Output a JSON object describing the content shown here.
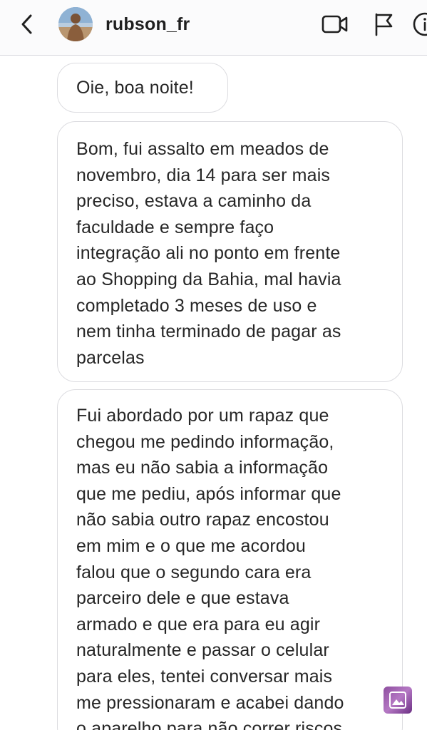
{
  "header": {
    "username": "rubson_fr",
    "icons": [
      "back-arrow-icon",
      "video-call-icon",
      "flag-icon",
      "info-icon"
    ]
  },
  "messages": [
    {
      "text": "Oie, boa noite!"
    },
    {
      "text": "Bom, fui assalto em meados de\nnovembro, dia 14 para ser mais\npreciso, estava a caminho da\nfaculdade e sempre faço\nintegração ali no ponto em frente\nao Shopping da Bahia, mal havia\ncompletado 3 meses de uso e\nnem tinha terminado de pagar as\nparcelas"
    },
    {
      "text": "Fui abordado por um rapaz que\nchegou me pedindo informação,\nmas eu não sabia a informação\nque me pediu, após informar que\nnão sabia outro rapaz encostou\nem mim e o que me acordou\nfalou que o segundo cara era\nparceiro dele e que estava\narmado e que era para eu agir\nnaturalmente e passar o celular\npara eles, tentei conversar mais\nme pressionaram e acabei dando\no aparelho para não correr riscos"
    }
  ],
  "colors": {
    "header_bg": "#fbfbfc",
    "bubble_border": "#dcdce0",
    "text": "#262626"
  }
}
